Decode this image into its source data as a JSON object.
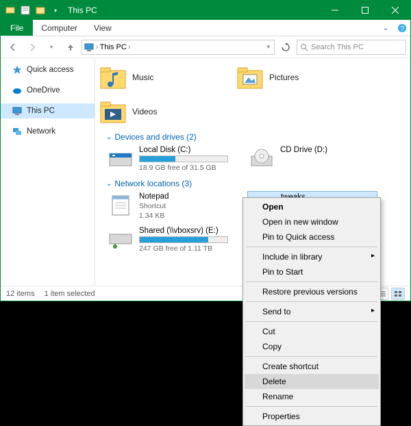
{
  "titlebar": {
    "title": "This PC"
  },
  "ribbon": {
    "file": "File",
    "tabs": [
      "Computer",
      "View"
    ]
  },
  "addrbar": {
    "breadcrumb": [
      "This PC"
    ],
    "search_placeholder": "Search This PC"
  },
  "sidebar": {
    "items": [
      {
        "label": "Quick access",
        "icon": "star-icon"
      },
      {
        "label": "OneDrive",
        "icon": "cloud-icon"
      },
      {
        "label": "This PC",
        "icon": "monitor-icon",
        "selected": true
      },
      {
        "label": "Network",
        "icon": "network-icon"
      }
    ]
  },
  "sections": {
    "folders": {
      "items": [
        {
          "label": "Music",
          "icon": "music-folder-icon"
        },
        {
          "label": "Pictures",
          "icon": "pictures-folder-icon"
        },
        {
          "label": "Videos",
          "icon": "videos-folder-icon"
        }
      ]
    },
    "drives": {
      "header": "Devices and drives (2)",
      "items": [
        {
          "name": "Local Disk (C:)",
          "free": "18.9 GB free of 31.5 GB",
          "fill": 41,
          "icon": "hdd-icon"
        },
        {
          "name": "CD Drive (D:)",
          "free": "",
          "fill": 0,
          "icon": "cd-icon"
        }
      ]
    },
    "network": {
      "header": "Network locations (3)",
      "items": [
        {
          "name": "Notepad",
          "sub1": "Shortcut",
          "sub2": "1.34 KB",
          "icon": "notepad-icon"
        },
        {
          "name": "tweaks",
          "sub1": "",
          "sub2": "",
          "icon": "folder-icon",
          "selected": true
        },
        {
          "name": "Shared (\\\\vboxsrv) (E:)",
          "sub1": "247 GB free of 1.11 TB",
          "sub2": "",
          "icon": "netdrive-icon",
          "fill": 78
        }
      ]
    }
  },
  "statusbar": {
    "count": "12 items",
    "selection": "1 item selected"
  },
  "context_menu": {
    "items": [
      {
        "label": "Open",
        "bold": true
      },
      {
        "label": "Open in new window"
      },
      {
        "label": "Pin to Quick access"
      },
      {
        "sep": true
      },
      {
        "label": "Include in library",
        "sub": true
      },
      {
        "label": "Pin to Start"
      },
      {
        "sep": true
      },
      {
        "label": "Restore previous versions"
      },
      {
        "sep": true
      },
      {
        "label": "Send to",
        "sub": true
      },
      {
        "sep": true
      },
      {
        "label": "Cut"
      },
      {
        "label": "Copy"
      },
      {
        "sep": true
      },
      {
        "label": "Create shortcut"
      },
      {
        "label": "Delete",
        "hover": true
      },
      {
        "label": "Rename"
      },
      {
        "sep": true
      },
      {
        "label": "Properties"
      }
    ]
  }
}
